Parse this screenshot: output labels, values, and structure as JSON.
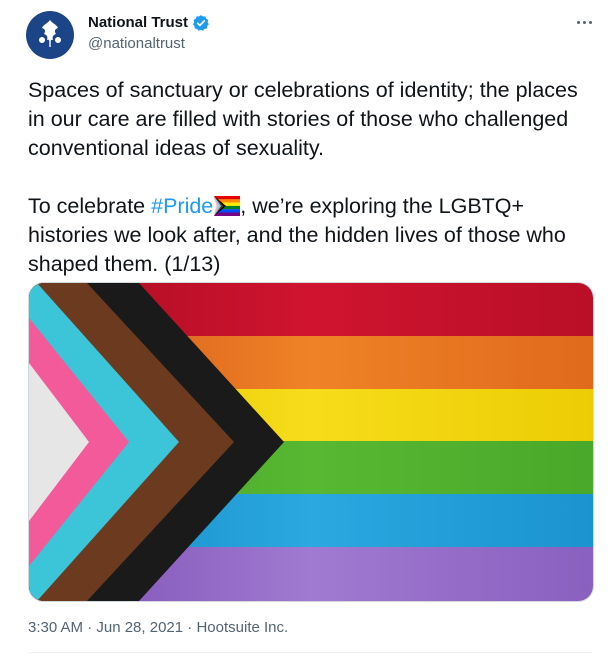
{
  "tweet": {
    "display_name": "National Trust",
    "handle": "@nationaltrust",
    "verified": true,
    "avatar_icon": "oak-leaf-icon",
    "more_icon": "more-dots-icon",
    "text_part1": "Spaces of sanctuary or celebrations of identity; the places in our care are filled with stories of those who challenged conventional ideas of sexuality.\n\nTo celebrate ",
    "hashtag": "#Pride",
    "emoji_icon": "progress-pride-flag-icon",
    "text_part2": ", we’re exploring the LGBTQ+ histories we look after, and the hidden lives of those who shaped them. (1/13)",
    "timestamp": "3:30 AM · Jun 28, 2021",
    "separator": " · ",
    "source": "Hootsuite Inc.",
    "media_icon": "progress-pride-flag-image"
  },
  "colors": {
    "brand": "#1c4587",
    "link": "#1d9bf0",
    "secondary_text": "#536471",
    "flag_red": "#c8102e",
    "flag_orange": "#e8731a",
    "flag_yellow": "#f2d400",
    "flag_green": "#4caf2a",
    "flag_blue": "#1a9bd7",
    "flag_purple": "#8a5cc2",
    "chevron_black": "#1a1a1a",
    "chevron_brown": "#6b3a1f",
    "chevron_cyan": "#3cc4d8",
    "chevron_pink": "#f25a9a",
    "chevron_white": "#e8e8e8"
  }
}
